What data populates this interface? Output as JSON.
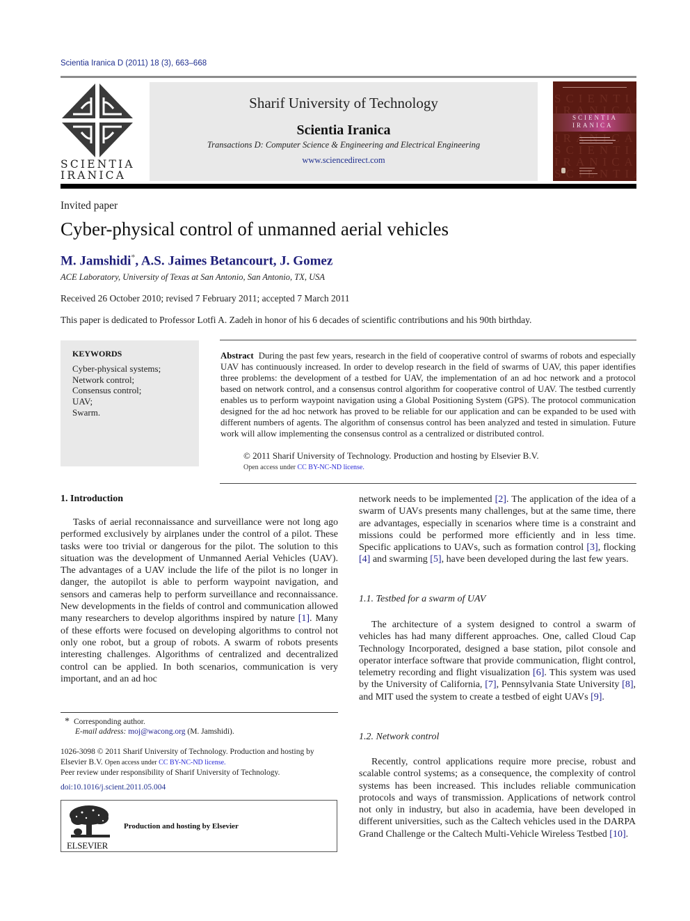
{
  "header": {
    "citation": "Scientia Iranica D (2011) 18 (3), 663–668",
    "logo_text_line1": "SCIENTIA",
    "logo_text_line2": "IRANICA",
    "university": "Sharif University of Technology",
    "journal": "Scientia Iranica",
    "transactions": "Transactions D: Computer Science & Engineering and Electrical Engineering",
    "url": "www.sciencedirect.com",
    "cover": {
      "background_word_1": "SCIENTIA",
      "background_word_2": "IRANICA",
      "band_title_1": "SCIENTIA",
      "band_title_2": "IRANICA"
    }
  },
  "article": {
    "type": "Invited paper",
    "title": "Cyber-physical control of unmanned aerial vehicles",
    "authors": [
      {
        "name": "M. Jamshidi",
        "mark": "*"
      },
      {
        "name": "A.S. Jaimes Betancourt"
      },
      {
        "name": "J. Gomez"
      }
    ],
    "affiliation": "ACE Laboratory, University of Texas at San Antonio, San Antonio, TX, USA",
    "received": "Received 26 October 2010; revised 7 February 2011; accepted 7 March 2011",
    "dedication": "This paper is dedicated to Professor Lotfi A. Zadeh in honor of his 6 decades of scientific contributions and his 90th birthday."
  },
  "keywords": {
    "title": "KEYWORDS",
    "items": [
      "Cyber-physical systems;",
      "Network control;",
      "Consensus control;",
      "UAV;",
      "Swarm."
    ]
  },
  "abstract": {
    "label": "Abstract",
    "text": "During the past few years, research in the field of cooperative control of swarms of robots and especially UAV has continuously increased. In order to develop research in the field of swarms of UAV, this paper identifies three problems: the development of a testbed for UAV, the implementation of an ad hoc network and a protocol based on network control, and a consensus control algorithm for cooperative control of UAV. The testbed currently enables us to perform waypoint navigation using a Global Positioning System (GPS). The protocol communication designed for the ad hoc network has proved to be reliable for our application and can be expanded to be used with different numbers of agents. The algorithm of consensus control has been analyzed and tested in simulation. Future work will allow implementing the consensus control as a centralized or distributed control.",
    "copyright": "© 2011 Sharif University of Technology. Production and hosting by Elsevier B.V.",
    "open_access_prefix": "Open access under ",
    "open_access_link": "CC BY-NC-ND license."
  },
  "body": {
    "intro_heading": "1.  Introduction",
    "intro_p1_a": "Tasks of aerial reconnaissance and surveillance were not long ago performed exclusively by airplanes under the control of a pilot. These tasks were too trivial or dangerous for the pilot. The solution to this situation was the development of Unmanned Aerial Vehicles (UAV). The advantages of a UAV include the life of the pilot is no longer in danger, the autopilot is able to perform waypoint navigation, and sensors and cameras help to perform surveillance and reconnaissance. New developments in the fields of control and communication allowed many researchers to develop algorithms inspired by nature ",
    "intro_cite_1": "[1]",
    "intro_p1_b": ". Many of these efforts were focused on developing algorithms to control not only one robot, but a group of robots. A swarm of robots presents interesting challenges. Algorithms of centralized and decentralized control can be applied. In both scenarios, communication is very important, and an ad hoc",
    "right_p1_a": "network needs to be implemented ",
    "cite_2": "[2]",
    "right_p1_b": ". The application of the idea of a swarm of UAVs presents many challenges, but at the same time, there are advantages, especially in scenarios where time is a constraint and missions could be performed more efficiently and in less time. Specific applications to UAVs, such as formation control ",
    "cite_3": "[3]",
    "right_p1_c": ", flocking ",
    "cite_4": "[4]",
    "right_p1_d": " and swarming ",
    "cite_5": "[5]",
    "right_p1_e": ", have been developed during the last few years.",
    "sub_1_1": "1.1.  Testbed for a swarm of UAV",
    "p2_a": "The architecture of a system designed to control a swarm of vehicles has had many different approaches. One, called Cloud Cap Technology Incorporated, designed a base station, pilot console and operator interface software that provide communication, flight control, telemetry recording and flight visualization ",
    "cite_6": "[6]",
    "p2_b": ". This system was used by the University of California, ",
    "cite_7": "[7]",
    "p2_c": ", Pennsylvania State University ",
    "cite_8": "[8]",
    "p2_d": ", and MIT used the system to create a testbed of eight UAVs ",
    "cite_9": "[9]",
    "p2_e": ".",
    "sub_1_2": "1.2.  Network control",
    "p3_a": "Recently, control applications require more precise, robust and scalable control systems; as a consequence, the complexity of control systems has been increased. This includes reliable communication protocols and ways of transmission. Applications of network control not only in industry, but also in academia, have been developed in different universities, such as the Caltech vehicles used in the DARPA Grand Challenge or the Caltech Multi-Vehicle Wireless Testbed ",
    "cite_10": "[10]",
    "p3_b": "."
  },
  "footer": {
    "footnote_star": "*",
    "corresponding": "Corresponding author.",
    "email_label": "E-mail address:",
    "email": "moj@wacong.org",
    "email_suffix": " (M. Jamshidi).",
    "issn_line": "1026-3098 © 2011 Sharif University of Technology.  Production and hosting by Elsevier B.V. ",
    "open_access_prefix": " Open access under ",
    "open_access_link": "CC BY-NC-ND license.",
    "peer_review": "Peer review under responsibility of Sharif  University of Technology.",
    "doi": "doi:10.1016/j.scient.2011.05.004",
    "elsevier_word": "ELSEVIER",
    "elsevier_text": "Production and hosting by Elsevier"
  },
  "colors": {
    "link_blue": "#1f1f8f",
    "license_blue": "#2a2ad6",
    "header_gray": "#e9e9e9",
    "cover_brown": "#5a1a12"
  }
}
